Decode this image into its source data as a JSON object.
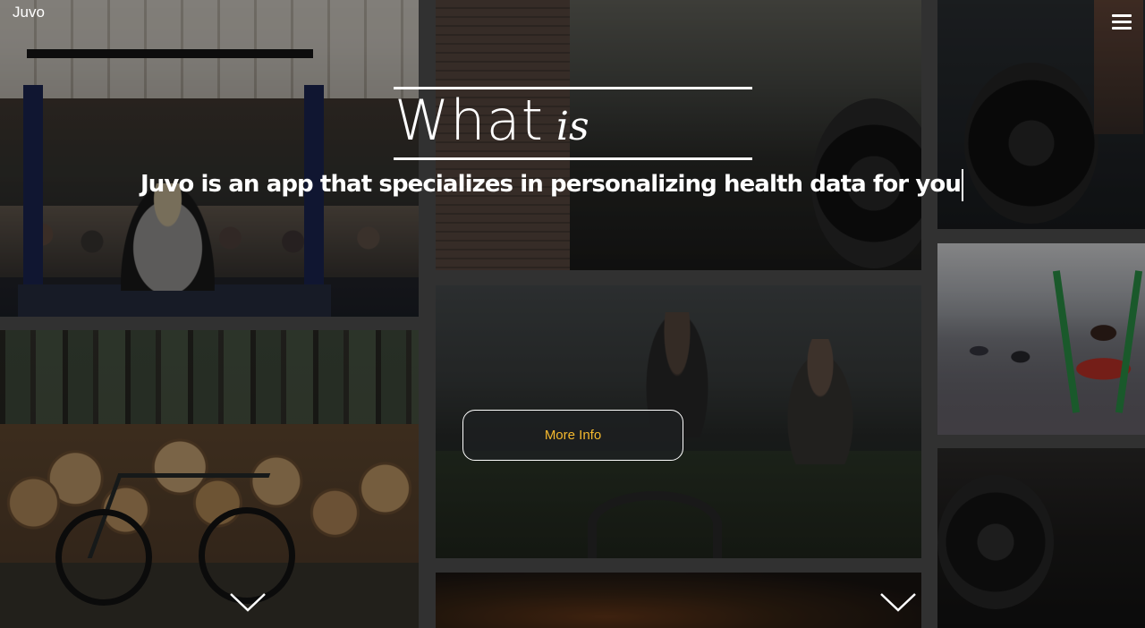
{
  "header": {
    "logo": "Juvo",
    "menu_icon": "hamburger-menu-icon"
  },
  "hero": {
    "headline_word1": "What",
    "headline_word2": "is",
    "tagline": "Juvo is an app that specializes in personalizing health data for you",
    "cta_label": "More Info",
    "cta_color": "#f5b92e"
  },
  "gallery": {
    "images": [
      "yoga-class",
      "rowing-machine",
      "barbell-plate",
      "resistance-band-class",
      "logs-and-bicycle",
      "battle-ropes",
      "rowing-flywheel",
      "dim-gym"
    ]
  },
  "scroll": {
    "down_icon": "chevron-down-icon"
  }
}
